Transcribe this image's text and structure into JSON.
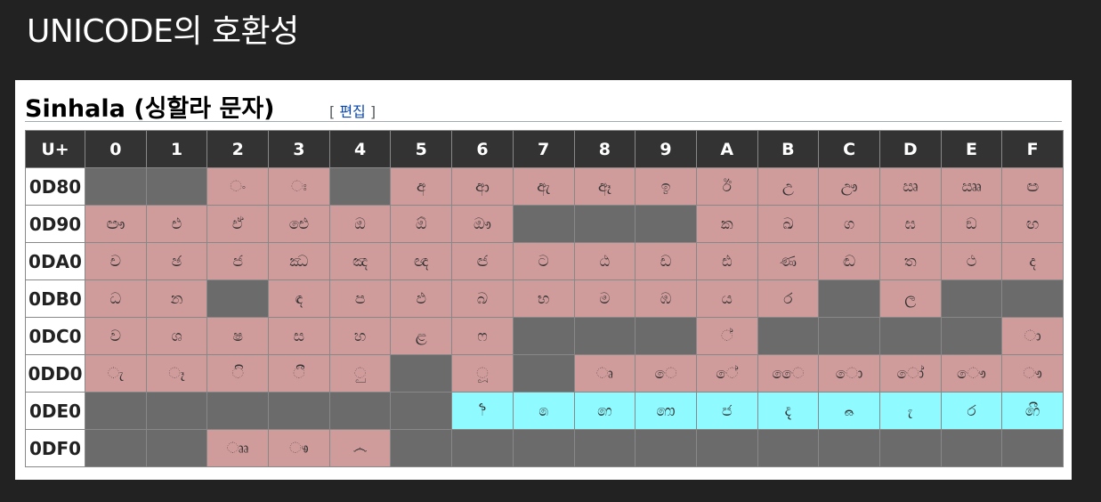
{
  "slide": {
    "title": "UNICODE의 호환성"
  },
  "section": {
    "heading": "Sinhala (싱할라 문자)",
    "edit_open": "[ ",
    "edit_label": "편집",
    "edit_close": " ]"
  },
  "table": {
    "corner": "U+",
    "columns": [
      "0",
      "1",
      "2",
      "3",
      "4",
      "5",
      "6",
      "7",
      "8",
      "9",
      "A",
      "B",
      "C",
      "D",
      "E",
      "F"
    ],
    "rows": [
      {
        "label": "0D80",
        "cells": [
          {
            "t": "",
            "s": "unassigned"
          },
          {
            "t": "",
            "s": "unassigned"
          },
          {
            "t": "ං",
            "s": "assigned"
          },
          {
            "t": "ඃ",
            "s": "assigned"
          },
          {
            "t": "",
            "s": "unassigned"
          },
          {
            "t": "අ",
            "s": "assigned"
          },
          {
            "t": "ආ",
            "s": "assigned"
          },
          {
            "t": "ඇ",
            "s": "assigned"
          },
          {
            "t": "ඈ",
            "s": "assigned"
          },
          {
            "t": "ඉ",
            "s": "assigned"
          },
          {
            "t": "ඊ",
            "s": "assigned"
          },
          {
            "t": "උ",
            "s": "assigned"
          },
          {
            "t": "ඌ",
            "s": "assigned"
          },
          {
            "t": "ඍ",
            "s": "assigned"
          },
          {
            "t": "ඎ",
            "s": "assigned"
          },
          {
            "t": "ඏ",
            "s": "assigned"
          }
        ]
      },
      {
        "label": "0D90",
        "cells": [
          {
            "t": "ඐ",
            "s": "assigned"
          },
          {
            "t": "එ",
            "s": "assigned"
          },
          {
            "t": "ඒ",
            "s": "assigned"
          },
          {
            "t": "ඓ",
            "s": "assigned"
          },
          {
            "t": "ඔ",
            "s": "assigned"
          },
          {
            "t": "ඕ",
            "s": "assigned"
          },
          {
            "t": "ඖ",
            "s": "assigned"
          },
          {
            "t": "",
            "s": "unassigned"
          },
          {
            "t": "",
            "s": "unassigned"
          },
          {
            "t": "",
            "s": "unassigned"
          },
          {
            "t": "ක",
            "s": "assigned"
          },
          {
            "t": "ඛ",
            "s": "assigned"
          },
          {
            "t": "ග",
            "s": "assigned"
          },
          {
            "t": "ඝ",
            "s": "assigned"
          },
          {
            "t": "ඞ",
            "s": "assigned"
          },
          {
            "t": "ඟ",
            "s": "assigned"
          }
        ]
      },
      {
        "label": "0DA0",
        "cells": [
          {
            "t": "ච",
            "s": "assigned"
          },
          {
            "t": "ඡ",
            "s": "assigned"
          },
          {
            "t": "ජ",
            "s": "assigned"
          },
          {
            "t": "ඣ",
            "s": "assigned"
          },
          {
            "t": "ඤ",
            "s": "assigned"
          },
          {
            "t": "ඥ",
            "s": "assigned"
          },
          {
            "t": "ඦ",
            "s": "assigned"
          },
          {
            "t": "ට",
            "s": "assigned"
          },
          {
            "t": "ඨ",
            "s": "assigned"
          },
          {
            "t": "ඩ",
            "s": "assigned"
          },
          {
            "t": "ඪ",
            "s": "assigned"
          },
          {
            "t": "ණ",
            "s": "assigned"
          },
          {
            "t": "ඬ",
            "s": "assigned"
          },
          {
            "t": "ත",
            "s": "assigned"
          },
          {
            "t": "ථ",
            "s": "assigned"
          },
          {
            "t": "ද",
            "s": "assigned"
          }
        ]
      },
      {
        "label": "0DB0",
        "cells": [
          {
            "t": "ධ",
            "s": "assigned"
          },
          {
            "t": "න",
            "s": "assigned"
          },
          {
            "t": "",
            "s": "unassigned"
          },
          {
            "t": "ඳ",
            "s": "assigned"
          },
          {
            "t": "ප",
            "s": "assigned"
          },
          {
            "t": "ඵ",
            "s": "assigned"
          },
          {
            "t": "බ",
            "s": "assigned"
          },
          {
            "t": "භ",
            "s": "assigned"
          },
          {
            "t": "ම",
            "s": "assigned"
          },
          {
            "t": "ඹ",
            "s": "assigned"
          },
          {
            "t": "ය",
            "s": "assigned"
          },
          {
            "t": "ර",
            "s": "assigned"
          },
          {
            "t": "",
            "s": "unassigned"
          },
          {
            "t": "ල",
            "s": "assigned"
          },
          {
            "t": "",
            "s": "unassigned"
          },
          {
            "t": "",
            "s": "unassigned"
          }
        ]
      },
      {
        "label": "0DC0",
        "cells": [
          {
            "t": "ව",
            "s": "assigned"
          },
          {
            "t": "ශ",
            "s": "assigned"
          },
          {
            "t": "ෂ",
            "s": "assigned"
          },
          {
            "t": "ස",
            "s": "assigned"
          },
          {
            "t": "හ",
            "s": "assigned"
          },
          {
            "t": "ළ",
            "s": "assigned"
          },
          {
            "t": "ෆ",
            "s": "assigned"
          },
          {
            "t": "",
            "s": "unassigned"
          },
          {
            "t": "",
            "s": "unassigned"
          },
          {
            "t": "",
            "s": "unassigned"
          },
          {
            "t": "්",
            "s": "assigned"
          },
          {
            "t": "",
            "s": "unassigned"
          },
          {
            "t": "",
            "s": "unassigned"
          },
          {
            "t": "",
            "s": "unassigned"
          },
          {
            "t": "",
            "s": "unassigned"
          },
          {
            "t": "ා",
            "s": "assigned"
          }
        ]
      },
      {
        "label": "0DD0",
        "cells": [
          {
            "t": "ැ",
            "s": "assigned"
          },
          {
            "t": "ෑ",
            "s": "assigned"
          },
          {
            "t": "ි",
            "s": "assigned"
          },
          {
            "t": "ී",
            "s": "assigned"
          },
          {
            "t": "ු",
            "s": "assigned"
          },
          {
            "t": "",
            "s": "unassigned"
          },
          {
            "t": "ූ",
            "s": "assigned"
          },
          {
            "t": "",
            "s": "unassigned"
          },
          {
            "t": "ෘ",
            "s": "assigned"
          },
          {
            "t": "ෙ",
            "s": "assigned"
          },
          {
            "t": "ේ",
            "s": "assigned"
          },
          {
            "t": "ෛ",
            "s": "assigned"
          },
          {
            "t": "ො",
            "s": "assigned"
          },
          {
            "t": "ෝ",
            "s": "assigned"
          },
          {
            "t": "ෞ",
            "s": "assigned"
          },
          {
            "t": "ෟ",
            "s": "assigned"
          }
        ]
      },
      {
        "label": "0DE0",
        "cells": [
          {
            "t": "",
            "s": "unassigned"
          },
          {
            "t": "",
            "s": "unassigned"
          },
          {
            "t": "",
            "s": "unassigned"
          },
          {
            "t": "",
            "s": "unassigned"
          },
          {
            "t": "",
            "s": "unassigned"
          },
          {
            "t": "",
            "s": "unassigned"
          },
          {
            "t": "෦",
            "s": "archaic"
          },
          {
            "t": "෧",
            "s": "archaic"
          },
          {
            "t": "෨",
            "s": "archaic"
          },
          {
            "t": "෩",
            "s": "archaic"
          },
          {
            "t": "෪",
            "s": "archaic"
          },
          {
            "t": "෫",
            "s": "archaic"
          },
          {
            "t": "෬",
            "s": "archaic"
          },
          {
            "t": "෭",
            "s": "archaic"
          },
          {
            "t": "෮",
            "s": "archaic"
          },
          {
            "t": "෯",
            "s": "archaic"
          }
        ]
      },
      {
        "label": "0DF0",
        "cells": [
          {
            "t": "",
            "s": "unassigned"
          },
          {
            "t": "",
            "s": "unassigned"
          },
          {
            "t": "ෲ",
            "s": "assigned"
          },
          {
            "t": "ෳ",
            "s": "assigned"
          },
          {
            "t": "෴",
            "s": "assigned"
          },
          {
            "t": "",
            "s": "unassigned"
          },
          {
            "t": "",
            "s": "unassigned"
          },
          {
            "t": "",
            "s": "unassigned"
          },
          {
            "t": "",
            "s": "unassigned"
          },
          {
            "t": "",
            "s": "unassigned"
          },
          {
            "t": "",
            "s": "unassigned"
          },
          {
            "t": "",
            "s": "unassigned"
          },
          {
            "t": "",
            "s": "unassigned"
          },
          {
            "t": "",
            "s": "unassigned"
          },
          {
            "t": "",
            "s": "unassigned"
          },
          {
            "t": "",
            "s": "unassigned"
          }
        ]
      }
    ]
  },
  "colors": {
    "background": "#222222",
    "assigned": "#d09b9b",
    "archaic": "#8ffaff",
    "unassigned": "#6b6b6b",
    "header": "#333333",
    "link": "#0645ad"
  }
}
